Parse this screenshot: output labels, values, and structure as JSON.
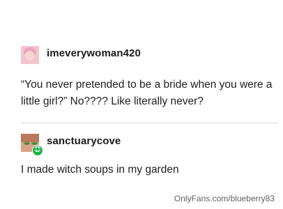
{
  "posts": [
    {
      "username": "imeverywoman420",
      "text": "“You never pretended to be a bride when you were a little girl?”  No???? Like literally never?"
    },
    {
      "username": "sanctuarycove",
      "text": "I made witch soups in my garden"
    }
  ],
  "watermark": "OnlyFans.com/blueberry83",
  "colors": {
    "reblog_badge": "#20b34a"
  },
  "icons": {
    "reblog": "reblog-icon"
  }
}
